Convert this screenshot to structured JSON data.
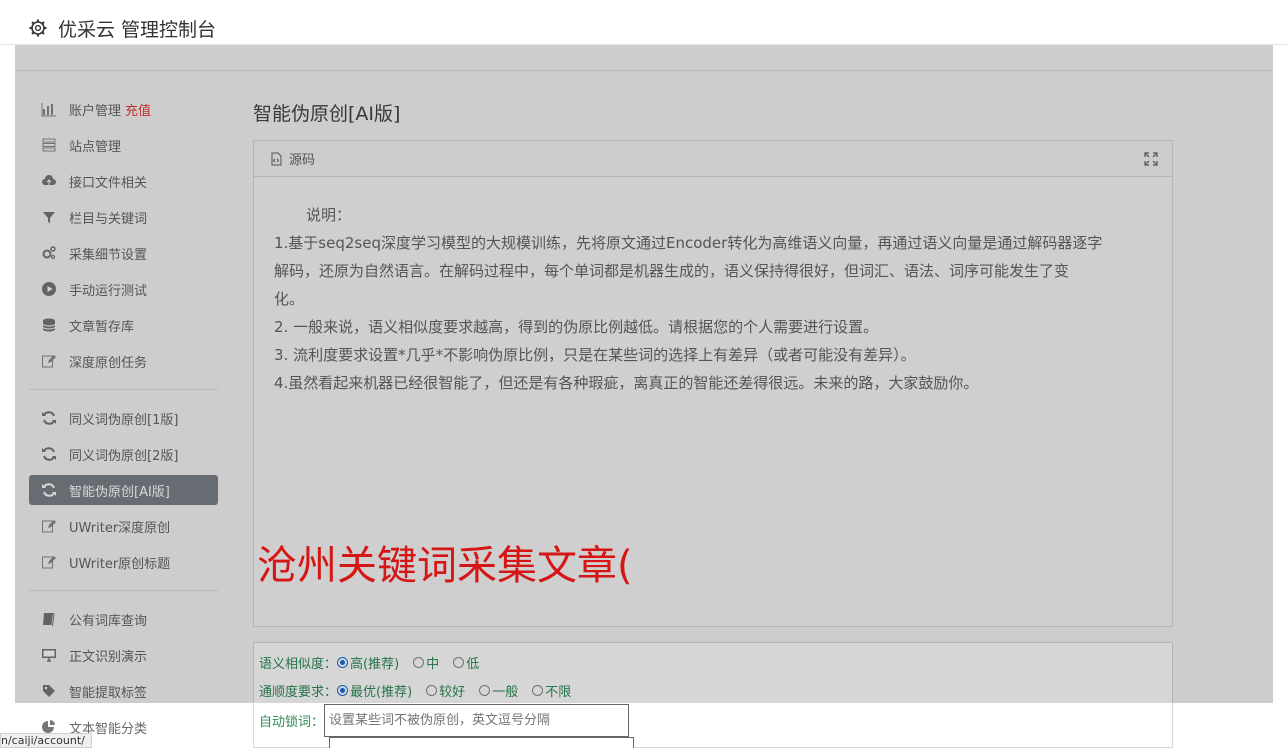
{
  "app": {
    "title": "优采云 管理控制台"
  },
  "sidebar": {
    "group1": [
      {
        "label": "账户管理",
        "accent": "充值",
        "icon": "bar-chart-icon"
      },
      {
        "label": "站点管理",
        "icon": "server-icon"
      },
      {
        "label": "接口文件相关",
        "icon": "cloud-upload-icon"
      },
      {
        "label": "栏目与关键词",
        "icon": "filter-icon"
      },
      {
        "label": "采集细节设置",
        "icon": "gears-icon"
      },
      {
        "label": "手动运行测试",
        "icon": "play-circle-icon"
      },
      {
        "label": "文章暂存库",
        "icon": "database-icon"
      },
      {
        "label": "深度原创任务",
        "icon": "edit-icon"
      }
    ],
    "group2": [
      {
        "label": "同义词伪原创[1版]",
        "icon": "refresh-icon"
      },
      {
        "label": "同义词伪原创[2版]",
        "icon": "refresh-icon"
      },
      {
        "label": "智能伪原创[AI版]",
        "icon": "refresh-icon",
        "active": true
      },
      {
        "label": "UWriter深度原创",
        "icon": "edit-icon"
      },
      {
        "label": "UWriter原创标题",
        "icon": "edit-icon"
      }
    ],
    "group3": [
      {
        "label": "公有词库查询",
        "icon": "book-icon"
      },
      {
        "label": "正文识别演示",
        "icon": "monitor-icon"
      },
      {
        "label": "智能提取标签",
        "icon": "tag-icon"
      },
      {
        "label": "文本智能分类",
        "icon": "pie-chart-icon"
      }
    ]
  },
  "main": {
    "title": "智能伪原创[AI版]",
    "panel": {
      "header": "源码",
      "note_title": "说明：",
      "lines": [
        "1.基于seq2seq深度学习模型的大规模训练，先将原文通过Encoder转化为高维语义向量，再通过语义向量是通过解码器逐字",
        "解码，还原为自然语言。在解码过程中，每个单词都是机器生成的，语义保持得很好，但词汇、语法、词序可能发生了变",
        "化。",
        "2. 一般来说，语义相似度要求越高，得到的伪原比例越低。请根据您的个人需要进行设置。",
        "3. 流利度要求设置*几乎*不影响伪原比例，只是在某些词的选择上有差异（或者可能没有差异）。",
        "4.虽然看起来机器已经很智能了，但还是有各种瑕疵，离真正的智能还差得很远。未来的路，大家鼓励你。"
      ]
    },
    "overlay": "沧州关键词采集文章(",
    "options": {
      "similarity_label": "语义相似度：",
      "similarity": [
        {
          "label": "高(推荐)",
          "checked": true
        },
        {
          "label": "中"
        },
        {
          "label": "低"
        }
      ],
      "fluency_label": "通顺度要求：",
      "fluency": [
        {
          "label": "最优(推荐)",
          "checked": true
        },
        {
          "label": "较好"
        },
        {
          "label": "一般"
        },
        {
          "label": "不限"
        }
      ],
      "lock_label": "自动锁词：",
      "lock_placeholder": "设置某些词不被伪原创，英文逗号分隔"
    }
  },
  "status_url": "n/caiji/account/"
}
